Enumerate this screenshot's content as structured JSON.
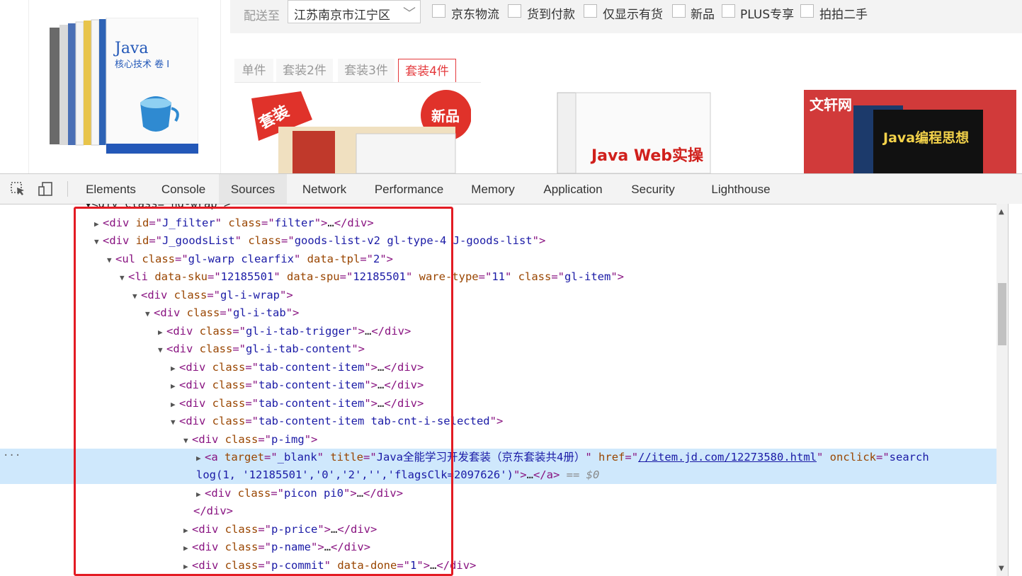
{
  "webpage": {
    "delivery_label": "配送至",
    "location": "江苏南京市江宁区",
    "filters": [
      "京东物流",
      "货到付款",
      "仅显示有货",
      "新品",
      "PLUS专享",
      "拍拍二手"
    ],
    "tabs": [
      "单件",
      "套装2件",
      "套装3件",
      "套装4件"
    ],
    "selected_tab": "套装4件",
    "hero_book_title": "Java",
    "hero_book_subtitle": "核心技术 卷 I",
    "thumb1_badge": "套装",
    "thumb1_new": "新品",
    "thumb2_title": "Java Web实操",
    "thumb3_brand": "文轩网",
    "thumb3_title": "Java编程思想"
  },
  "devtools": {
    "tabs": [
      "Elements",
      "Console",
      "Sources",
      "Network",
      "Performance",
      "Memory",
      "Application",
      "Security",
      "Lighthouse"
    ],
    "active_tab": "Sources",
    "selected_element_marker": "== $0",
    "lines": [
      {
        "text": "▼<div class=\"hd-wrap\">"
      },
      {
        "t1": "J_filter",
        "t2": "filter"
      },
      {
        "t1": "J_goodsList",
        "t2": "goods-list-v2 gl-type-4 J-goods-list"
      },
      {
        "t1": "gl-warp clearfix",
        "t2": "2"
      },
      {
        "sku": "12185501",
        "spu": "12185501",
        "ware": "11",
        "cls": "gl-item"
      },
      {
        "cls": "gl-i-wrap"
      },
      {
        "cls": "gl-i-tab"
      },
      {
        "cls": "gl-i-tab-trigger"
      },
      {
        "cls": "gl-i-tab-content"
      },
      {
        "cls": "tab-content-item"
      },
      {
        "cls": "tab-content-item"
      },
      {
        "cls": "tab-content-item"
      },
      {
        "cls": "tab-content-item tab-cnt-i-selected"
      },
      {
        "cls": "p-img"
      },
      {
        "target": "_blank",
        "title": "Java全能学习开发套装（京东套装共4册）",
        "href": "//item.jd.com/12273580.html",
        "onclick_a": "search",
        "onclick_b": "log(1, '12185501','0','2','','flagsClk=2097626')"
      },
      {
        "cls": "picon pi0"
      },
      {
        "close": "</div>"
      },
      {
        "cls": "p-price"
      },
      {
        "cls": "p-name"
      },
      {
        "cls": "p-commit",
        "done": "1"
      }
    ]
  },
  "colors": {
    "highlight": "#cfe8fc",
    "tag": "#881280",
    "attr_name": "#994500",
    "attr_value": "#1a1aa6",
    "red_box": "#e31b23",
    "jd_red": "#e4393c"
  }
}
